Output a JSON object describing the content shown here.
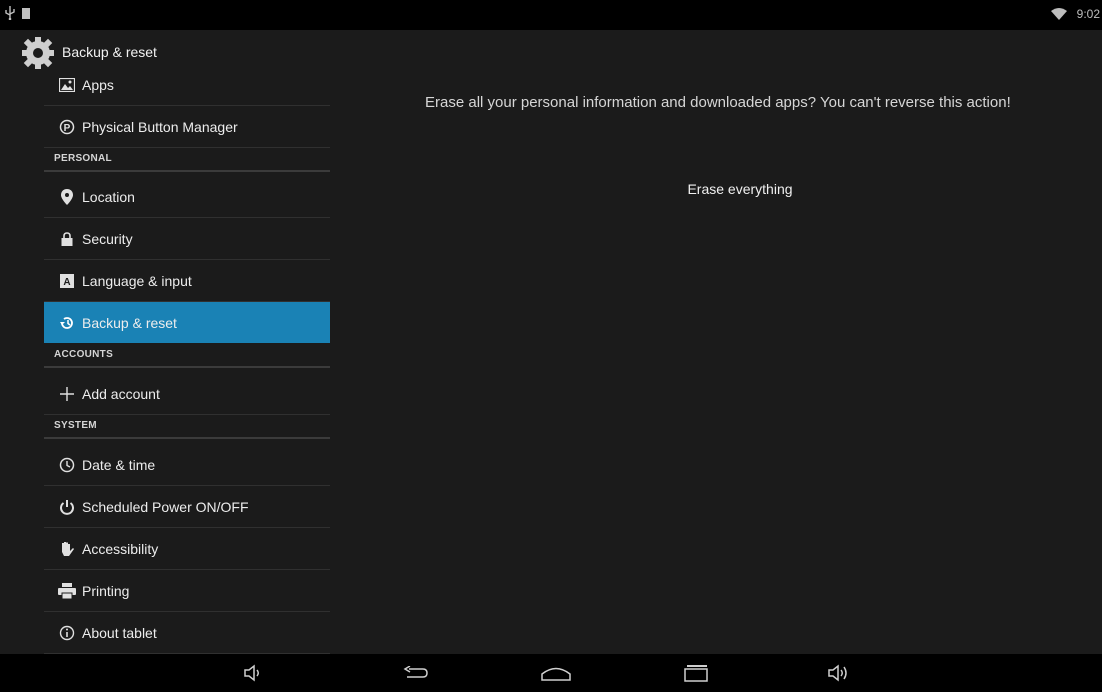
{
  "status_bar": {
    "time": "9:02"
  },
  "action_bar": {
    "title": "Backup & reset",
    "icon": "settings-gear-icon"
  },
  "sidebar": {
    "items": [
      {
        "label": "Apps",
        "icon": "apps-icon"
      },
      {
        "label": "Physical Button Manager",
        "icon": "physical-button-icon"
      },
      {
        "header": "PERSONAL"
      },
      {
        "label": "Location",
        "icon": "location-pin-icon"
      },
      {
        "label": "Security",
        "icon": "lock-icon"
      },
      {
        "label": "Language & input",
        "icon": "keyboard-a-icon"
      },
      {
        "label": "Backup & reset",
        "icon": "restore-icon",
        "selected": true
      },
      {
        "header": "ACCOUNTS"
      },
      {
        "label": "Add account",
        "icon": "plus-icon"
      },
      {
        "header": "SYSTEM"
      },
      {
        "label": "Date & time",
        "icon": "clock-icon"
      },
      {
        "label": "Scheduled Power ON/OFF",
        "icon": "power-icon"
      },
      {
        "label": "Accessibility",
        "icon": "hand-icon"
      },
      {
        "label": "Printing",
        "icon": "printer-icon"
      },
      {
        "label": "About tablet",
        "icon": "info-icon"
      }
    ],
    "selected_color": "#1a82b5"
  },
  "content": {
    "message": "Erase all your personal information and downloaded apps? You can't reverse this action!",
    "button_label": "Erase everything"
  },
  "nav_bar": {
    "buttons": [
      "volume-down-icon",
      "back-icon",
      "home-icon",
      "recents-icon",
      "volume-up-icon"
    ]
  }
}
